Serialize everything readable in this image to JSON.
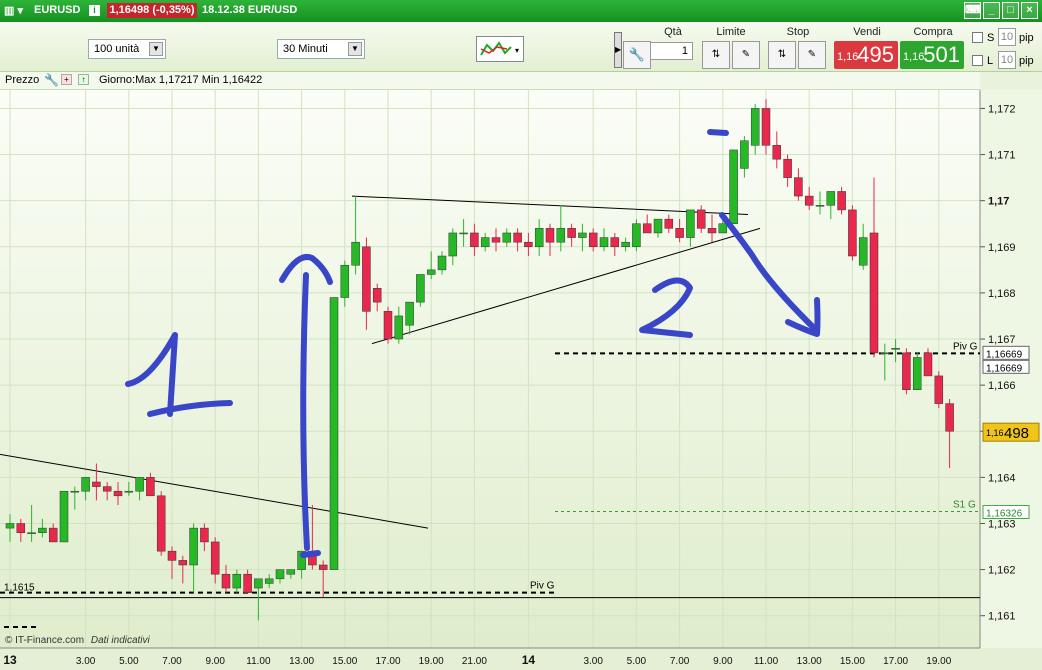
{
  "titlebar": {
    "symbol": "EURUSD",
    "change": "1,16498 (-0,35%)",
    "time": "18.12.38 EUR/USD"
  },
  "toolbar": {
    "quantity_select": "100 unità",
    "timeframe_select": "30 Minuti",
    "qty_label": "Qtà",
    "qty_value": "1",
    "limit_label": "Limite",
    "stop_label": "Stop",
    "sell_label": "Vendi",
    "buy_label": "Compra",
    "sell_prefix": "1,16",
    "sell_price": "495",
    "buy_prefix": "1,16",
    "buy_price": "501",
    "s_label": "S",
    "s_value": "10",
    "l_label": "L",
    "l_value": "10",
    "pip_label": "pip"
  },
  "subbar": {
    "price_label": "Prezzo",
    "range_text": "Giorno:Max 1,17217 Min 1,16422"
  },
  "footer": {
    "copyright": "© IT-Finance.com",
    "note": "Dati indicativi"
  },
  "colors": {
    "up": "#27b827",
    "down": "#e8284c",
    "annotation": "#3a46c8"
  },
  "chart_data": {
    "type": "candlestick",
    "ylim": [
      1.1603,
      1.1724
    ],
    "y_ticks": [
      "1,172",
      "1,171",
      "1,17",
      "1,169",
      "1,168",
      "1,167",
      "1,166",
      "1,165",
      "1,164",
      "1,163",
      "1,162",
      "1,161"
    ],
    "x_tick_labels": [
      "13",
      "3.00",
      "5.00",
      "7.00",
      "9.00",
      "11.00",
      "13.00",
      "15.00",
      "17.00",
      "19.00",
      "21.00",
      "14",
      "3.00",
      "5.00",
      "7.00",
      "9.00",
      "11.00",
      "13.00",
      "15.00",
      "17.00",
      "19.00"
    ],
    "x_tick_index": [
      0,
      7,
      11,
      15,
      19,
      23,
      27,
      31,
      35,
      39,
      43,
      48,
      54,
      58,
      62,
      66,
      70,
      74,
      78,
      82,
      86
    ],
    "candles": [
      {
        "o": 1.1629,
        "h": 1.1632,
        "l": 1.1626,
        "c": 1.163
      },
      {
        "o": 1.163,
        "h": 1.1631,
        "l": 1.1626,
        "c": 1.1628
      },
      {
        "o": 1.1628,
        "h": 1.1634,
        "l": 1.1626,
        "c": 1.1628
      },
      {
        "o": 1.1628,
        "h": 1.1631,
        "l": 1.1627,
        "c": 1.1629
      },
      {
        "o": 1.1629,
        "h": 1.163,
        "l": 1.1626,
        "c": 1.1626
      },
      {
        "o": 1.1626,
        "h": 1.1637,
        "l": 1.1626,
        "c": 1.1637
      },
      {
        "o": 1.1637,
        "h": 1.1638,
        "l": 1.1633,
        "c": 1.1637
      },
      {
        "o": 1.1637,
        "h": 1.164,
        "l": 1.1635,
        "c": 1.164
      },
      {
        "o": 1.1639,
        "h": 1.1643,
        "l": 1.1635,
        "c": 1.1638
      },
      {
        "o": 1.1638,
        "h": 1.1639,
        "l": 1.1635,
        "c": 1.1637
      },
      {
        "o": 1.1637,
        "h": 1.1639,
        "l": 1.1634,
        "c": 1.1636
      },
      {
        "o": 1.1637,
        "h": 1.1639,
        "l": 1.1636,
        "c": 1.1637
      },
      {
        "o": 1.1637,
        "h": 1.164,
        "l": 1.1635,
        "c": 1.164
      },
      {
        "o": 1.164,
        "h": 1.1641,
        "l": 1.1636,
        "c": 1.1636
      },
      {
        "o": 1.1636,
        "h": 1.1637,
        "l": 1.1623,
        "c": 1.1624
      },
      {
        "o": 1.1624,
        "h": 1.1625,
        "l": 1.1618,
        "c": 1.1622
      },
      {
        "o": 1.1622,
        "h": 1.1623,
        "l": 1.1617,
        "c": 1.1621
      },
      {
        "o": 1.1621,
        "h": 1.163,
        "l": 1.1615,
        "c": 1.1629
      },
      {
        "o": 1.1629,
        "h": 1.163,
        "l": 1.1624,
        "c": 1.1626
      },
      {
        "o": 1.1626,
        "h": 1.1627,
        "l": 1.1617,
        "c": 1.1619
      },
      {
        "o": 1.1619,
        "h": 1.1621,
        "l": 1.1615,
        "c": 1.1616
      },
      {
        "o": 1.1616,
        "h": 1.162,
        "l": 1.1615,
        "c": 1.1619
      },
      {
        "o": 1.1619,
        "h": 1.162,
        "l": 1.1615,
        "c": 1.1615
      },
      {
        "o": 1.1616,
        "h": 1.1618,
        "l": 1.1609,
        "c": 1.1618
      },
      {
        "o": 1.1617,
        "h": 1.1619,
        "l": 1.1616,
        "c": 1.1618
      },
      {
        "o": 1.1618,
        "h": 1.162,
        "l": 1.1617,
        "c": 1.162
      },
      {
        "o": 1.1619,
        "h": 1.162,
        "l": 1.1618,
        "c": 1.162
      },
      {
        "o": 1.162,
        "h": 1.1624,
        "l": 1.1618,
        "c": 1.1624
      },
      {
        "o": 1.1624,
        "h": 1.1634,
        "l": 1.162,
        "c": 1.1621
      },
      {
        "o": 1.1621,
        "h": 1.1622,
        "l": 1.1614,
        "c": 1.162
      },
      {
        "o": 1.162,
        "h": 1.1679,
        "l": 1.162,
        "c": 1.1679
      },
      {
        "o": 1.1679,
        "h": 1.1687,
        "l": 1.1677,
        "c": 1.1686
      },
      {
        "o": 1.1686,
        "h": 1.1701,
        "l": 1.1684,
        "c": 1.1691
      },
      {
        "o": 1.169,
        "h": 1.1692,
        "l": 1.1672,
        "c": 1.1676
      },
      {
        "o": 1.1681,
        "h": 1.1682,
        "l": 1.1676,
        "c": 1.1678
      },
      {
        "o": 1.1676,
        "h": 1.1677,
        "l": 1.1669,
        "c": 1.167
      },
      {
        "o": 1.167,
        "h": 1.1677,
        "l": 1.1669,
        "c": 1.1675
      },
      {
        "o": 1.1673,
        "h": 1.1678,
        "l": 1.1671,
        "c": 1.1678
      },
      {
        "o": 1.1678,
        "h": 1.1684,
        "l": 1.1677,
        "c": 1.1684
      },
      {
        "o": 1.1684,
        "h": 1.1689,
        "l": 1.1683,
        "c": 1.1685
      },
      {
        "o": 1.1685,
        "h": 1.1689,
        "l": 1.1684,
        "c": 1.1688
      },
      {
        "o": 1.1688,
        "h": 1.1694,
        "l": 1.1686,
        "c": 1.1693
      },
      {
        "o": 1.1693,
        "h": 1.1696,
        "l": 1.169,
        "c": 1.1693
      },
      {
        "o": 1.1693,
        "h": 1.1695,
        "l": 1.1688,
        "c": 1.169
      },
      {
        "o": 1.169,
        "h": 1.1693,
        "l": 1.1689,
        "c": 1.1692
      },
      {
        "o": 1.1692,
        "h": 1.1694,
        "l": 1.1689,
        "c": 1.1691
      },
      {
        "o": 1.1691,
        "h": 1.1694,
        "l": 1.169,
        "c": 1.1693
      },
      {
        "o": 1.1693,
        "h": 1.1694,
        "l": 1.1689,
        "c": 1.1691
      },
      {
        "o": 1.1691,
        "h": 1.1693,
        "l": 1.1688,
        "c": 1.169
      },
      {
        "o": 1.169,
        "h": 1.1696,
        "l": 1.1688,
        "c": 1.1694
      },
      {
        "o": 1.1694,
        "h": 1.1695,
        "l": 1.1688,
        "c": 1.1691
      },
      {
        "o": 1.1691,
        "h": 1.1699,
        "l": 1.1689,
        "c": 1.1694
      },
      {
        "o": 1.1694,
        "h": 1.1695,
        "l": 1.169,
        "c": 1.1692
      },
      {
        "o": 1.1692,
        "h": 1.1695,
        "l": 1.1689,
        "c": 1.1693
      },
      {
        "o": 1.1693,
        "h": 1.1694,
        "l": 1.1689,
        "c": 1.169
      },
      {
        "o": 1.169,
        "h": 1.1694,
        "l": 1.1689,
        "c": 1.1692
      },
      {
        "o": 1.1692,
        "h": 1.1693,
        "l": 1.1688,
        "c": 1.169
      },
      {
        "o": 1.169,
        "h": 1.1692,
        "l": 1.1689,
        "c": 1.1691
      },
      {
        "o": 1.169,
        "h": 1.1696,
        "l": 1.1689,
        "c": 1.1695
      },
      {
        "o": 1.1695,
        "h": 1.1697,
        "l": 1.1693,
        "c": 1.1693
      },
      {
        "o": 1.1693,
        "h": 1.1696,
        "l": 1.1692,
        "c": 1.1696
      },
      {
        "o": 1.1696,
        "h": 1.1697,
        "l": 1.1693,
        "c": 1.1694
      },
      {
        "o": 1.1694,
        "h": 1.1696,
        "l": 1.1691,
        "c": 1.1692
      },
      {
        "o": 1.1692,
        "h": 1.1698,
        "l": 1.169,
        "c": 1.1698
      },
      {
        "o": 1.1698,
        "h": 1.1699,
        "l": 1.1693,
        "c": 1.1694
      },
      {
        "o": 1.1694,
        "h": 1.1697,
        "l": 1.1691,
        "c": 1.1693
      },
      {
        "o": 1.1693,
        "h": 1.1697,
        "l": 1.1693,
        "c": 1.1695
      },
      {
        "o": 1.1695,
        "h": 1.1711,
        "l": 1.1695,
        "c": 1.1711
      },
      {
        "o": 1.1707,
        "h": 1.1714,
        "l": 1.1705,
        "c": 1.1713
      },
      {
        "o": 1.1712,
        "h": 1.1721,
        "l": 1.171,
        "c": 1.172
      },
      {
        "o": 1.172,
        "h": 1.1722,
        "l": 1.171,
        "c": 1.1712
      },
      {
        "o": 1.1712,
        "h": 1.1715,
        "l": 1.1707,
        "c": 1.1709
      },
      {
        "o": 1.1709,
        "h": 1.171,
        "l": 1.1703,
        "c": 1.1705
      },
      {
        "o": 1.1705,
        "h": 1.1707,
        "l": 1.17,
        "c": 1.1701
      },
      {
        "o": 1.1701,
        "h": 1.1703,
        "l": 1.1698,
        "c": 1.1699
      },
      {
        "o": 1.1699,
        "h": 1.1702,
        "l": 1.1697,
        "c": 1.1699
      },
      {
        "o": 1.1699,
        "h": 1.1702,
        "l": 1.1696,
        "c": 1.1702
      },
      {
        "o": 1.1702,
        "h": 1.1703,
        "l": 1.1697,
        "c": 1.1698
      },
      {
        "o": 1.1698,
        "h": 1.1699,
        "l": 1.1687,
        "c": 1.1688
      },
      {
        "o": 1.1686,
        "h": 1.1695,
        "l": 1.1685,
        "c": 1.1692
      },
      {
        "o": 1.1693,
        "h": 1.1705,
        "l": 1.1666,
        "c": 1.1667
      },
      {
        "o": 1.1667,
        "h": 1.1669,
        "l": 1.1661,
        "c": 1.1667
      },
      {
        "o": 1.1668,
        "h": 1.167,
        "l": 1.1665,
        "c": 1.1668
      },
      {
        "o": 1.1667,
        "h": 1.1668,
        "l": 1.1658,
        "c": 1.1659
      },
      {
        "o": 1.1659,
        "h": 1.1667,
        "l": 1.1659,
        "c": 1.1666
      },
      {
        "o": 1.1667,
        "h": 1.1668,
        "l": 1.1662,
        "c": 1.1662
      },
      {
        "o": 1.1662,
        "h": 1.1663,
        "l": 1.1655,
        "c": 1.1656
      },
      {
        "o": 1.1656,
        "h": 1.1657,
        "l": 1.1642,
        "c": 1.165
      }
    ],
    "levels": [
      {
        "label": "Piv G",
        "value_label": "1,16669",
        "value": 1.16669,
        "style": "dashed-black"
      },
      {
        "label": "S1 G",
        "value_label": "1,16326",
        "value": 1.16326,
        "style": "dashed-green"
      },
      {
        "label": "Piv G",
        "value_label": "1,1615",
        "value": 1.1615,
        "style": "dashed-black"
      }
    ],
    "right_labels": [
      "1,16669",
      "1,16326"
    ],
    "last_price_prefix": "1,16",
    "last_price": "498",
    "annotations": [
      "1",
      "2"
    ]
  }
}
